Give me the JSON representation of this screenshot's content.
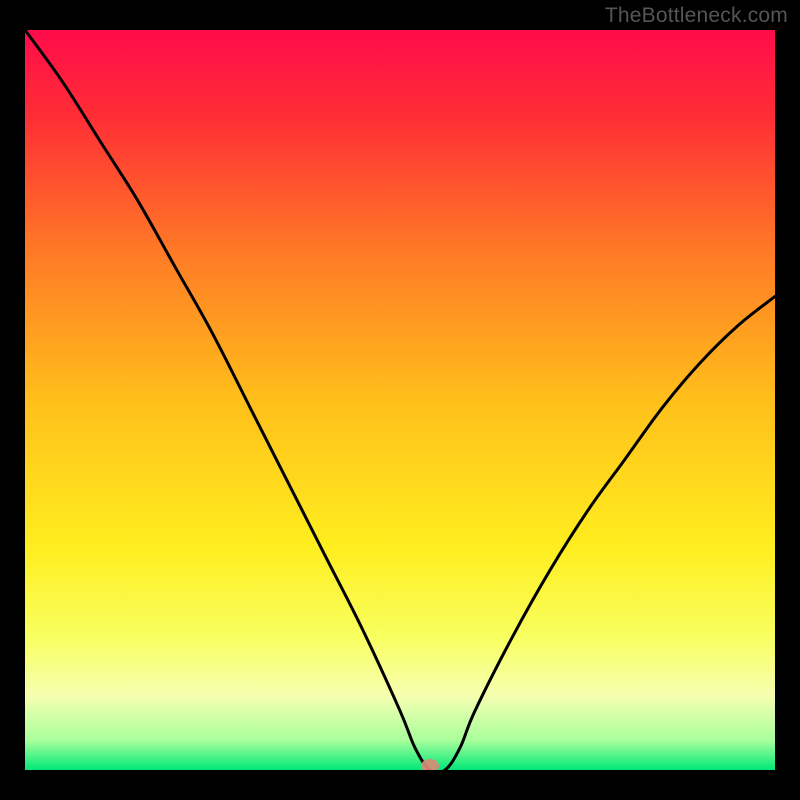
{
  "watermark": "TheBottleneck.com",
  "chart_data": {
    "type": "line",
    "title": "",
    "xlabel": "",
    "ylabel": "",
    "xlim": [
      0,
      100
    ],
    "ylim": [
      0,
      100
    ],
    "notes": "V-shaped bottleneck curve on vertical rainbow gradient background. Minimum (~0%) occurs near x≈54. Curve values are percentage bottleneck (y) vs. relative component strength (x). Values estimated from pixels.",
    "x": [
      0,
      5,
      10,
      15,
      20,
      25,
      30,
      35,
      40,
      45,
      50,
      52,
      54,
      56,
      58,
      60,
      65,
      70,
      75,
      80,
      85,
      90,
      95,
      100
    ],
    "values": [
      100,
      93,
      85,
      77,
      68,
      59,
      49,
      39,
      29,
      19,
      8,
      3,
      0,
      0,
      3,
      8,
      18,
      27,
      35,
      42,
      49,
      55,
      60,
      64
    ],
    "marker": {
      "x": 54,
      "y": 0
    },
    "gradient_stops": [
      {
        "offset": 0.0,
        "color": "#ff0b4a"
      },
      {
        "offset": 0.12,
        "color": "#ff2f35"
      },
      {
        "offset": 0.3,
        "color": "#ff7a26"
      },
      {
        "offset": 0.5,
        "color": "#ffbf1a"
      },
      {
        "offset": 0.7,
        "color": "#ffee1f"
      },
      {
        "offset": 0.82,
        "color": "#f8ff60"
      },
      {
        "offset": 0.9,
        "color": "#f6ffb0"
      },
      {
        "offset": 0.96,
        "color": "#a8ff9c"
      },
      {
        "offset": 1.0,
        "color": "#00e878"
      }
    ]
  }
}
